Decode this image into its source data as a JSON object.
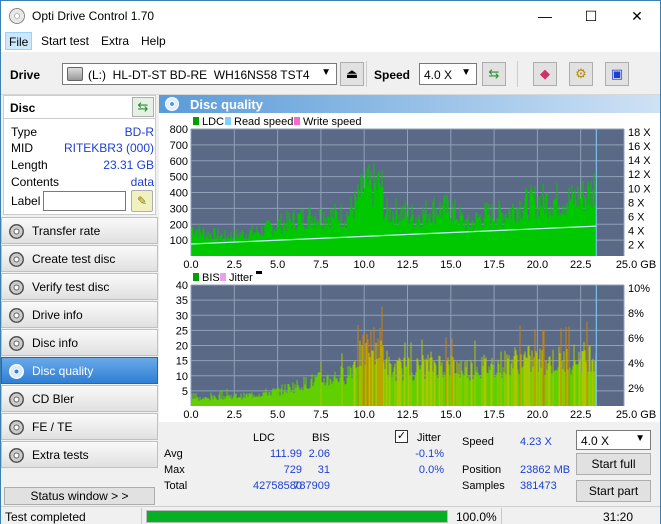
{
  "window": {
    "title": "Opti Drive Control 1.70",
    "minimize": "—",
    "maximize": "☐",
    "close": "✕"
  },
  "menu": [
    "File",
    "Start test",
    "Extra",
    "Help"
  ],
  "toolbar": {
    "drive_label": "Drive",
    "drive_value": "(L:)  HL-DT-ST BD-RE  WH16NS58 TST4",
    "speed_label": "Speed",
    "speed_value": "4.0 X"
  },
  "disc": {
    "header": "Disc",
    "rows": [
      {
        "key": "Type",
        "value": "BD-R"
      },
      {
        "key": "MID",
        "value": "RITEKBR3 (000)"
      },
      {
        "key": "Length",
        "value": "23.31 GB"
      },
      {
        "key": "Contents",
        "value": "data"
      }
    ],
    "label_key": "Label",
    "label_value": ""
  },
  "nav": [
    {
      "label": "Transfer rate",
      "active": false
    },
    {
      "label": "Create test disc",
      "active": false
    },
    {
      "label": "Verify test disc",
      "active": false
    },
    {
      "label": "Drive info",
      "active": false
    },
    {
      "label": "Disc info",
      "active": false
    },
    {
      "label": "Disc quality",
      "active": true
    },
    {
      "label": "CD Bler",
      "active": false
    },
    {
      "label": "FE / TE",
      "active": false
    },
    {
      "label": "Extra tests",
      "active": false
    }
  ],
  "status_window_btn": "Status window > >",
  "panel_title": "Disc quality",
  "chart_data": [
    {
      "type": "bar",
      "legend": [
        "LDC",
        "Read speed",
        "Write speed"
      ],
      "colors": {
        "LDC": "#00c800",
        "Read speed": "#7fd0ff",
        "Write speed": "#ff66cc",
        "background": "#5a6a86",
        "grid": "#8fa0b8"
      },
      "x_ticks": [
        "0.0",
        "2.5",
        "5.0",
        "7.5",
        "10.0",
        "12.5",
        "15.0",
        "17.5",
        "20.0",
        "22.5",
        "25.0 GB"
      ],
      "y_left_ticks": [
        "800",
        "700",
        "600",
        "500",
        "400",
        "300",
        "200",
        "100"
      ],
      "y_right_ticks": [
        "18 X",
        "16 X",
        "14 X",
        "12 X",
        "10 X",
        "8 X",
        "6 X",
        "4 X",
        "2 X"
      ],
      "xlim": [
        0,
        25
      ],
      "ylim": [
        0,
        800
      ],
      "y2lim": [
        0,
        18
      ],
      "data_end": 23.4,
      "ldc_profile": {
        "x": [
          0,
          1,
          2,
          3,
          4,
          5,
          6,
          7,
          8,
          9,
          9.5,
          10,
          11,
          11.2,
          12,
          13,
          14,
          15,
          16,
          17,
          18,
          19,
          20,
          21,
          22,
          23,
          23.4
        ],
        "y": [
          220,
          170,
          150,
          170,
          190,
          240,
          280,
          310,
          310,
          310,
          400,
          520,
          550,
          330,
          340,
          300,
          360,
          360,
          240,
          320,
          320,
          390,
          420,
          430,
          430,
          480,
          560
        ]
      },
      "read_speed": {
        "x": [
          0,
          23.4
        ],
        "y": [
          1.7,
          4.23
        ]
      }
    },
    {
      "type": "bar",
      "legend": [
        "BIS",
        "Jitter"
      ],
      "colors": {
        "BIS": "#00c800",
        "Jitter": "#e8a0e8",
        "background": "#5a6a86",
        "grid": "#8fa0b8"
      },
      "x_ticks": [
        "0.0",
        "2.5",
        "5.0",
        "7.5",
        "10.0",
        "12.5",
        "15.0",
        "17.5",
        "20.0",
        "22.5",
        "25.0 GB"
      ],
      "y_left_ticks": [
        "40",
        "35",
        "30",
        "25",
        "20",
        "15",
        "10",
        "5"
      ],
      "y_right_ticks": [
        "10%",
        "8%",
        "6%",
        "4%",
        "2%"
      ],
      "xlim": [
        0,
        25
      ],
      "ylim": [
        0,
        40
      ],
      "data_end": 23.4,
      "bis_profile": {
        "x": [
          0,
          1,
          2,
          3,
          4,
          5,
          6,
          7,
          8,
          9,
          9.5,
          10,
          10.5,
          11,
          11.5,
          12,
          13,
          14,
          15,
          16,
          17,
          18,
          19,
          20,
          21,
          22,
          23,
          23.4
        ],
        "y": [
          3,
          3,
          4,
          4,
          5,
          6,
          8,
          10,
          11,
          13,
          18,
          22,
          25,
          24,
          14,
          15,
          15,
          17,
          16,
          15,
          16,
          17,
          19,
          18,
          18,
          19,
          20,
          21
        ]
      }
    }
  ],
  "stats": {
    "col_ldc": "LDC",
    "col_bis": "BIS",
    "jitter_label": "Jitter",
    "jitter_checked": "✓",
    "rows": [
      {
        "label": "Avg",
        "ldc": "111.99",
        "bis": "2.06",
        "jitter": "-0.1%"
      },
      {
        "label": "Max",
        "ldc": "729",
        "bis": "31",
        "jitter": "0.0%"
      },
      {
        "label": "Total",
        "ldc": "42758580",
        "bis": "787909",
        "jitter": ""
      }
    ],
    "speed_label": "Speed",
    "speed_value": "4.23 X",
    "position_label": "Position",
    "position_value": "23862 MB",
    "samples_label": "Samples",
    "samples_value": "381473",
    "speed_select": "4.0 X",
    "start_full": "Start full",
    "start_part": "Start part"
  },
  "statusbar": {
    "text": "Test completed",
    "progress": 1.0,
    "percent": "100.0%",
    "time": "31:20"
  }
}
